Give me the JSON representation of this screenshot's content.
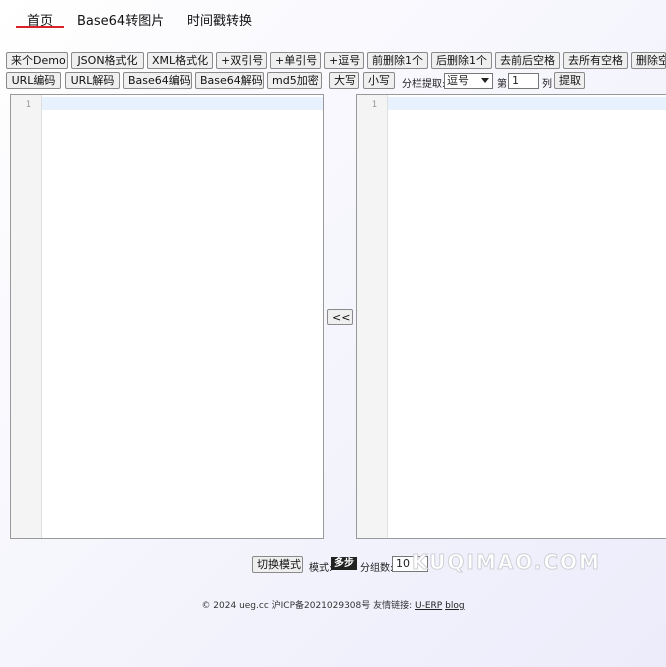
{
  "nav": {
    "items": [
      "首页",
      "Base64转图片",
      "时间戳转换"
    ]
  },
  "toolbar": {
    "row1": [
      "来个Demo",
      "JSON格式化",
      "XML格式化",
      "+双引号",
      "+单引号",
      "+逗号",
      "前删除1个",
      "后删除1个",
      "去前后空格",
      "去所有空格",
      "删除空"
    ],
    "row2": [
      "URL编码",
      "URL解码",
      "Base64编码",
      "Base64解码",
      "md5加密",
      "大写",
      "小写"
    ],
    "split_label": "分栏提取:",
    "separator_value": "逗号",
    "nth_label": "第",
    "column_value": "1",
    "column_label": "列",
    "extract_button": "提取"
  },
  "editors": {
    "left_line": "1",
    "right_line": "1"
  },
  "swap_button": "<<",
  "mode_bar": {
    "switch_button": "切换模式",
    "mode_label": "模式:",
    "mode_value": "多步",
    "group_label": "分组数:",
    "group_value": "10"
  },
  "watermark": "KUQIMAO.COM",
  "footer": {
    "text": "© 2024 ueg.cc 沪ICP备2021029308号 友情链接:",
    "link1": "U-ERP",
    "link2": "blog"
  }
}
